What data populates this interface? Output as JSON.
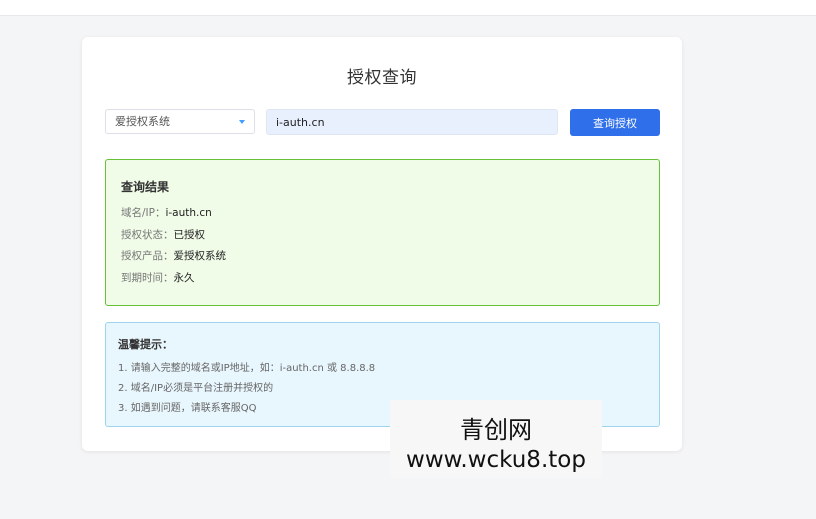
{
  "page": {
    "title": "授权查询"
  },
  "form": {
    "product_select": {
      "selected": "爱授权系统"
    },
    "domain_input": {
      "value": "i-auth.cn",
      "placeholder": ""
    },
    "query_button": "查询授权"
  },
  "result": {
    "title": "查询结果",
    "rows": [
      {
        "label": "域名/IP：",
        "value": "i-auth.cn"
      },
      {
        "label": "授权状态：",
        "value": "已授权"
      },
      {
        "label": "授权产品：",
        "value": "爱授权系统"
      },
      {
        "label": "到期时间：",
        "value": "永久"
      }
    ]
  },
  "tips": {
    "title": "温馨提示：",
    "items": [
      "1. 请输入完整的域名或IP地址，如：i-auth.cn 或 8.8.8.8",
      "2. 域名/IP必须是平台注册并授权的",
      "3. 如遇到问题，请联系客服QQ"
    ]
  },
  "watermark": {
    "line1": "青创网",
    "line2": "www.wcku8.top"
  },
  "colors": {
    "accent": "#2f6fea",
    "success_border": "#67c23a",
    "success_bg": "#f0fbe8",
    "info_border": "#9fd4ef",
    "info_bg": "#e8f6fd"
  }
}
